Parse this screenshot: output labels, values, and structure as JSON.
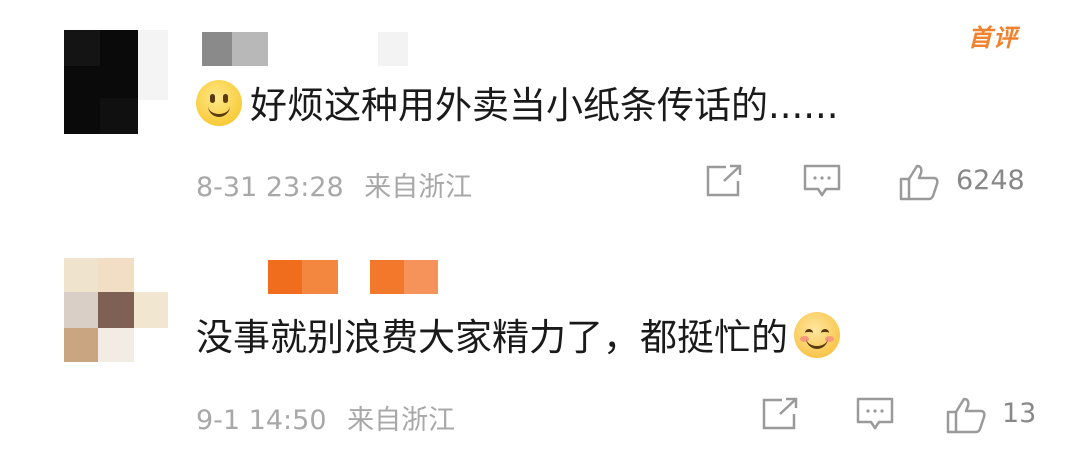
{
  "comments": [
    {
      "content": "好烦这种用外卖当小纸条传话的......",
      "date": "8-31 23:28",
      "location": "来自浙江",
      "likes": "6248",
      "badge": "首评",
      "emoji": "smile-emoji"
    },
    {
      "content": "没事就别浪费大家精力了，都挺忙的",
      "date": "9-1 14:50",
      "location": "来自浙江",
      "likes": "13",
      "emoji": "happy-emoji"
    }
  ],
  "icons": {
    "share": "share-icon",
    "reply": "comment-icon",
    "like": "thumbs-up-icon"
  },
  "colors": {
    "badge": "#f0822f",
    "meta_text": "#a8a8a8",
    "content_text": "#1a1a1a",
    "redacted_name": "#f07426"
  }
}
